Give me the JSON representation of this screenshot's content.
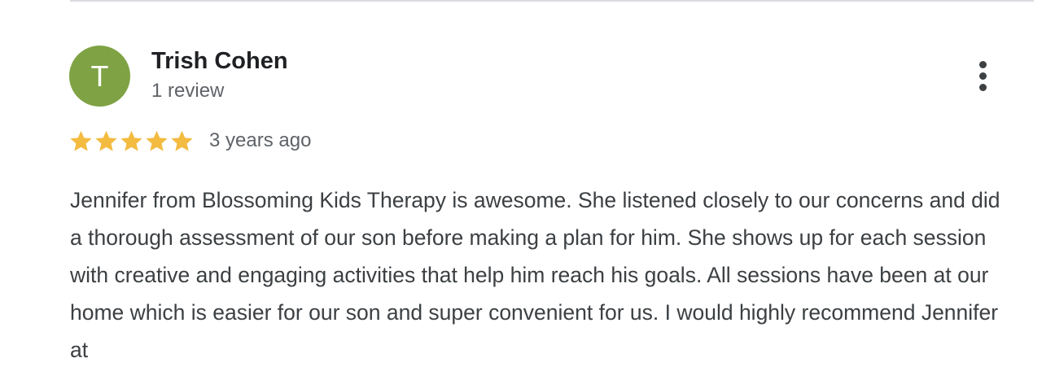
{
  "review": {
    "reviewer": {
      "initial": "T",
      "name": "Trish Cohen",
      "review_count": "1 review",
      "avatar_color": "#7fa344"
    },
    "rating": {
      "stars": 5,
      "max_stars": 5,
      "star_color": "#f4bb41",
      "icon": "star-icon"
    },
    "date": "3 years ago",
    "more_options_icon": "more-vert-icon",
    "text": "Jennifer from Blossoming Kids Therapy is awesome. She listened closely to our concerns and did a thorough assessment of our son before making a plan for him. She shows up for each session with creative and engaging activities that help him reach his goals. All sessions have been at our home which is easier for our son and super convenient for us. I would highly recommend Jennifer at"
  }
}
